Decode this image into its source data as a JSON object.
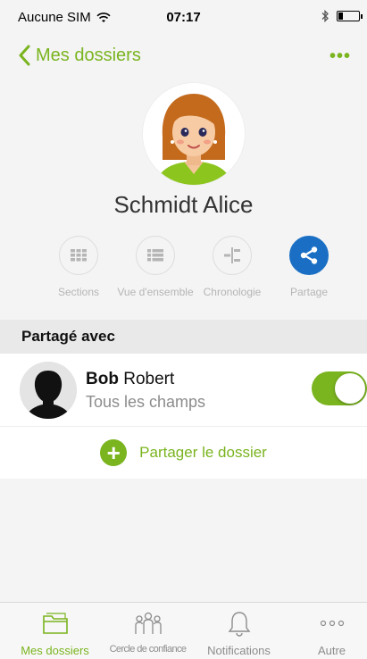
{
  "status_bar": {
    "carrier": "Aucune SIM",
    "time": "07:17"
  },
  "nav": {
    "back_label": "Mes dossiers",
    "more_label": "•••"
  },
  "profile": {
    "name": "Schmidt Alice"
  },
  "actions": [
    {
      "label": "Sections",
      "icon": "grid-icon"
    },
    {
      "label": "Vue d'ensemble",
      "icon": "list-icon"
    },
    {
      "label": "Chronologie",
      "icon": "timeline-icon"
    },
    {
      "label": "Partage",
      "icon": "share-icon",
      "active": true
    }
  ],
  "shared_section": {
    "title": "Partagé avec",
    "contacts": [
      {
        "first_name": "Bob",
        "last_name": "Robert",
        "subtitle": "Tous les champs",
        "enabled": true
      }
    ],
    "share_button_label": "Partager le dossier"
  },
  "tabs": [
    {
      "label": "Mes dossiers",
      "icon": "folder-icon",
      "active": true
    },
    {
      "label": "Cercle de confiance",
      "icon": "people-icon"
    },
    {
      "label": "Notifications",
      "icon": "bell-icon"
    },
    {
      "label": "Autre",
      "icon": "more-icon"
    }
  ],
  "colors": {
    "accent": "#7ab41f",
    "share_active": "#1a6fc4"
  }
}
